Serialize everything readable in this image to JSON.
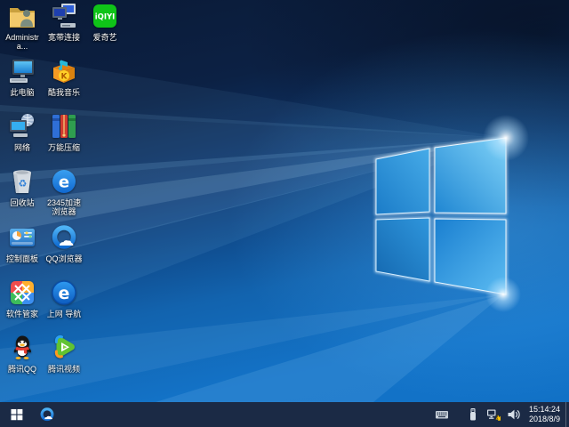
{
  "wallpaper": {
    "name": "windows-10-hero-blue"
  },
  "desktop": {
    "icons": [
      {
        "label": "Administra...",
        "icon": "user-folder",
        "col": 0,
        "row": 0
      },
      {
        "label": "宽带连接",
        "icon": "broadband",
        "col": 1,
        "row": 0
      },
      {
        "label": "爱奇艺",
        "icon": "iqiyi",
        "col": 2,
        "row": 0
      },
      {
        "label": "此电脑",
        "icon": "this-pc",
        "col": 0,
        "row": 1
      },
      {
        "label": "酷我音乐",
        "icon": "kuwo-music",
        "col": 1,
        "row": 1
      },
      {
        "label": "网络",
        "icon": "network",
        "col": 0,
        "row": 2
      },
      {
        "label": "万能压缩",
        "icon": "compressor",
        "col": 1,
        "row": 2
      },
      {
        "label": "回收站",
        "icon": "recycle-bin",
        "col": 0,
        "row": 3
      },
      {
        "label": "2345加速浏览器",
        "icon": "browser-2345",
        "col": 1,
        "row": 3
      },
      {
        "label": "控制面板",
        "icon": "control-panel",
        "col": 0,
        "row": 4
      },
      {
        "label": "QQ浏览器",
        "icon": "qq-browser",
        "col": 1,
        "row": 4
      },
      {
        "label": "软件管家",
        "icon": "software-manager",
        "col": 0,
        "row": 5
      },
      {
        "label": "上网 导航",
        "icon": "web-nav",
        "col": 1,
        "row": 5
      },
      {
        "label": "腾讯QQ",
        "icon": "tencent-qq",
        "col": 0,
        "row": 6
      },
      {
        "label": "腾讯视频",
        "icon": "tencent-video",
        "col": 1,
        "row": 6
      }
    ]
  },
  "taskbar": {
    "pinned": [
      {
        "name": "qq-browser"
      }
    ],
    "tray_icons": [
      {
        "name": "touch-keyboard"
      },
      {
        "name": "usb-device"
      },
      {
        "name": "network-warning"
      },
      {
        "name": "volume"
      }
    ],
    "clock": {
      "time": "15:14:24",
      "date": "2018/8/9"
    }
  },
  "colors": {
    "taskbar": "#1b2a45",
    "wallpaper_accent": "#1373c8",
    "iqiyi_green": "#0fc318",
    "warning_yellow": "#ffc400"
  }
}
